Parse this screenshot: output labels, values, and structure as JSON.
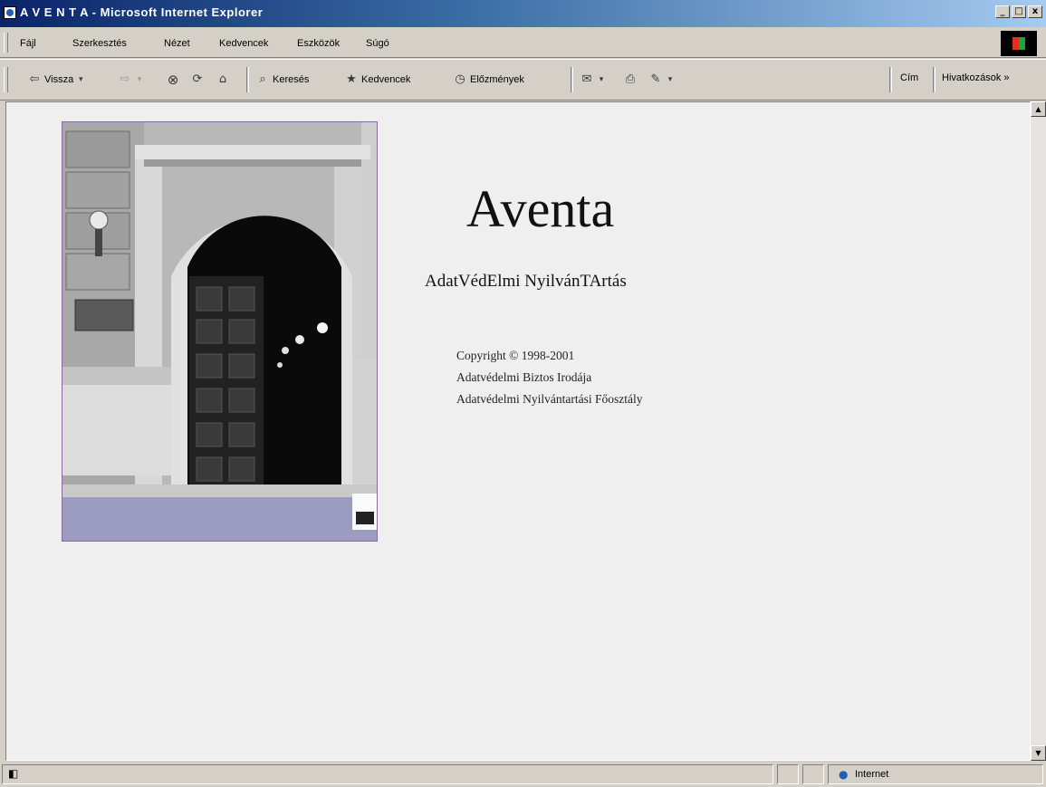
{
  "window": {
    "title": "A V E N T A - Microsoft Internet Explorer",
    "minimize": "_",
    "maximize": "□",
    "close": "x"
  },
  "menu": [
    "Fájl",
    "Szerkesztés",
    "Nézet",
    "Kedvencek",
    "Eszközök",
    "Súgó"
  ],
  "toolbar": {
    "back": "Vissza",
    "search": "Keresés",
    "favorites": "Kedvencek",
    "history": "Előzmények",
    "address_label": "Cím",
    "links_label": "Hivatkozások",
    "chevron": "»"
  },
  "page": {
    "heading": "Aventa",
    "subheading": "AdatVédElmi NyilvánTArtás",
    "copyright": "Copyright © 1998-2001",
    "line2": "Adatvédelmi Biztos Irodája",
    "line3": "Adatvédelmi Nyilvántartási Főosztály"
  },
  "status": {
    "zone": "Internet"
  },
  "colors": {
    "titlebar_start": "#0a246a",
    "titlebar_end": "#a6caf0",
    "content_bg": "#efefef",
    "chrome": "#d4d0c8"
  }
}
